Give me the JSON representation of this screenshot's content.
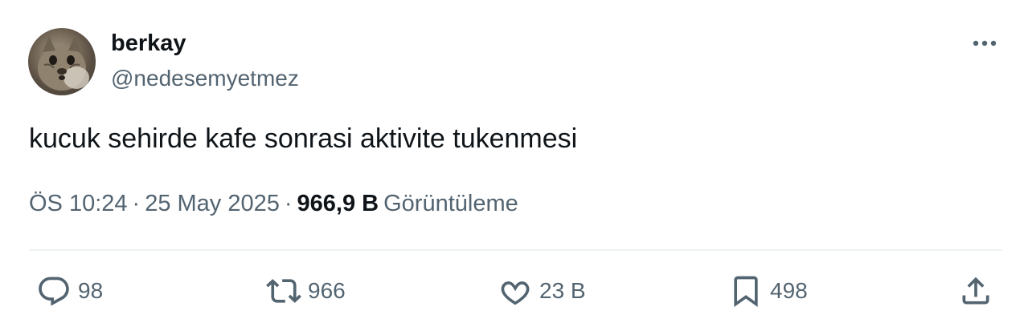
{
  "author": {
    "display_name": "berkay",
    "handle": "@nedesemyetmez"
  },
  "tweet": {
    "text": "kucuk sehirde kafe sonrasi aktivite tukenmesi",
    "time": "ÖS 10:24",
    "date": "25 May 2025",
    "separator": "·",
    "views_count": "966,9 B",
    "views_label": "Görüntüleme"
  },
  "actions": {
    "reply_count": "98",
    "retweet_count": "966",
    "like_count": "23 B",
    "bookmark_count": "498"
  },
  "icons": {
    "more": "more-horizontal-icon",
    "reply": "reply-bubble-icon",
    "retweet": "retweet-arrows-icon",
    "like": "heart-icon",
    "bookmark": "bookmark-icon",
    "share": "share-upload-icon"
  },
  "colors": {
    "text_primary": "#0f1419",
    "text_secondary": "#536471",
    "divider": "#eff3f4"
  }
}
